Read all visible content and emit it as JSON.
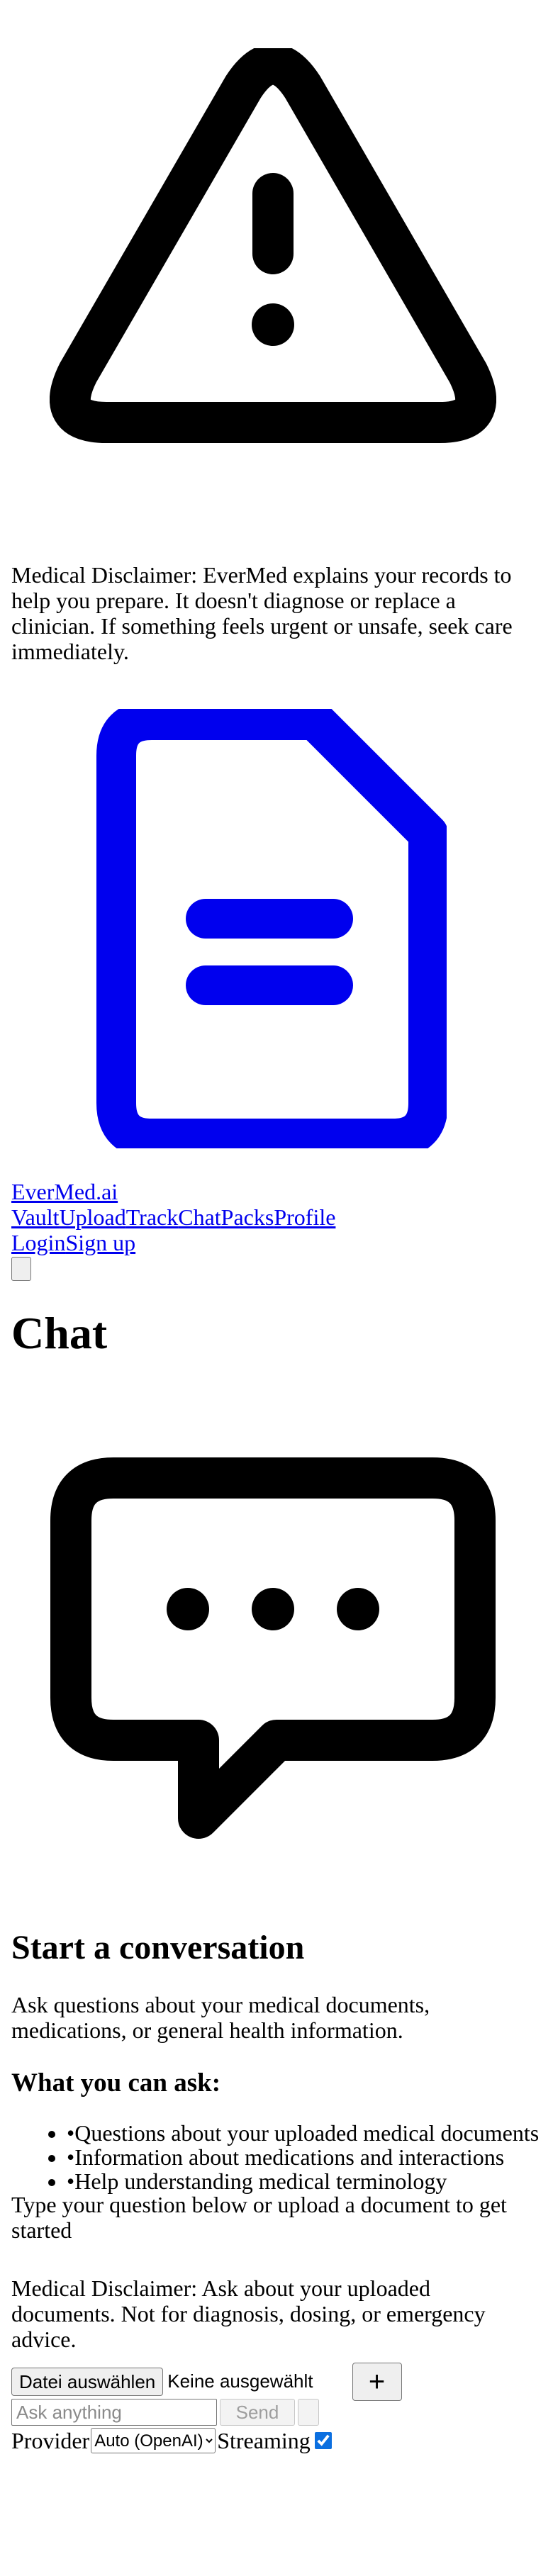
{
  "disclaimer_top": "Medical Disclaimer: EverMed explains your records to help you prepare. It doesn't diagnose or replace a clinician. If something feels urgent or unsafe, seek care immediately.",
  "icons": {
    "warning": "alert-triangle-icon",
    "document": "file-text-icon",
    "chat": "message-dots-icon",
    "document_color": "#0000ee"
  },
  "nav": {
    "brand": "EverMed.ai",
    "links": [
      "Vault",
      "Upload",
      "Track",
      "Chat",
      "Packs",
      "Profile"
    ],
    "auth": [
      "Login",
      "Sign up"
    ]
  },
  "page_title": "Chat",
  "empty_state": {
    "heading": "Start a conversation",
    "intro": "Ask questions about your medical documents, medications, or general health information.",
    "ask_heading": "What you can ask:",
    "examples": [
      "•Questions about your uploaded medical documents",
      "•Information about medications and interactions",
      "•Help understanding medical terminology"
    ],
    "hint": "Type your question below or upload a document to get started"
  },
  "disclaimer_bottom": "Medical Disclaimer: Ask about your uploaded documents. Not for diagnosis, dosing, or emergency advice.",
  "composer": {
    "file_button": "Datei auswählen",
    "file_status": "Keine ausgewählt",
    "plus_label": "+",
    "input_placeholder": "Ask anything",
    "send_label": "Send",
    "provider_label": "Provider",
    "provider_selected": "Auto (OpenAI)",
    "streaming_label": "Streaming",
    "streaming_checked": true
  }
}
